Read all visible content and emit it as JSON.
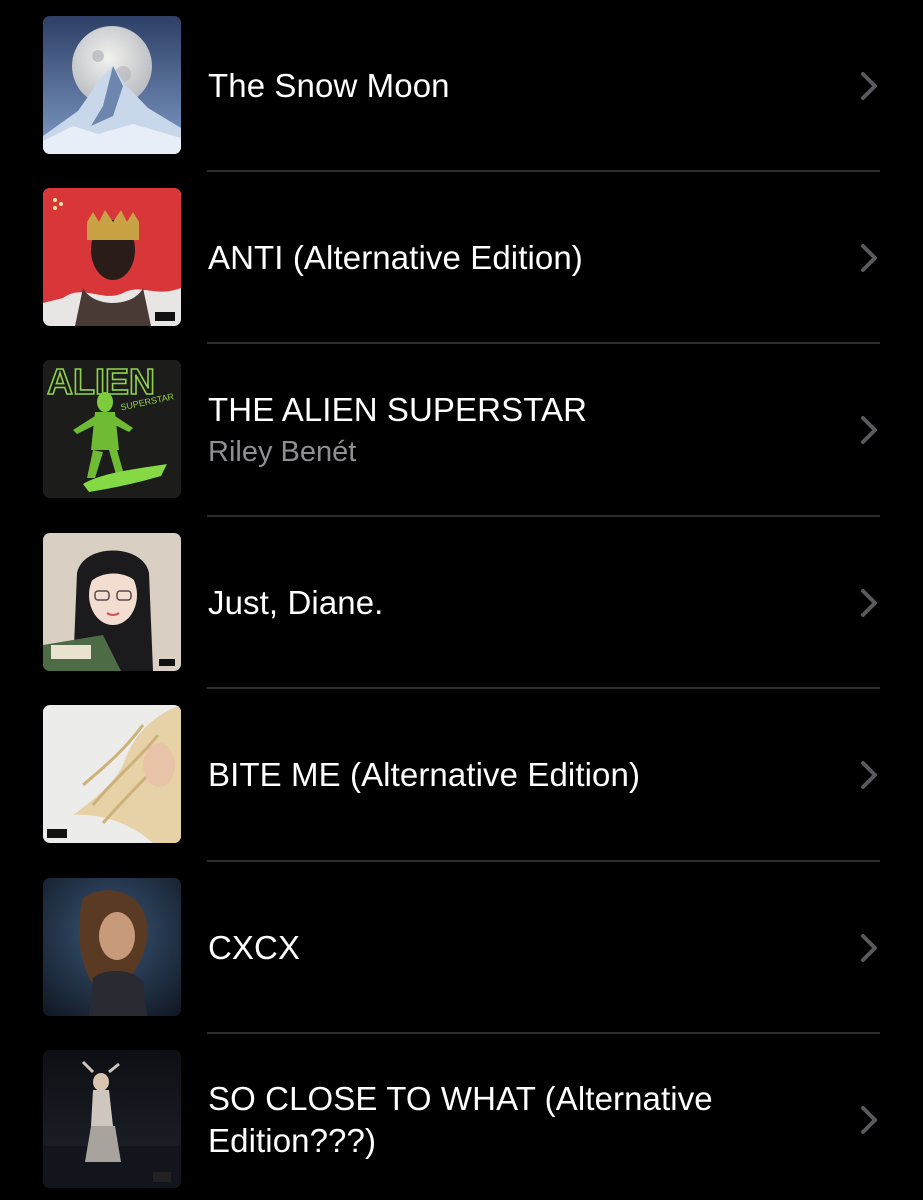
{
  "albums": [
    {
      "title": "The Snow Moon",
      "subtitle": "",
      "icon": "chevron-right-icon"
    },
    {
      "title": "ANTI (Alternative Edition)",
      "subtitle": "",
      "icon": "chevron-right-icon"
    },
    {
      "title": "THE ALIEN SUPERSTAR",
      "subtitle": "Riley Benét",
      "icon": "chevron-right-icon"
    },
    {
      "title": "Just, Diane.",
      "subtitle": "",
      "icon": "chevron-right-icon"
    },
    {
      "title": "BITE ME (Alternative Edition)",
      "subtitle": "",
      "icon": "chevron-right-icon"
    },
    {
      "title": "CXCX",
      "subtitle": "",
      "icon": "chevron-right-icon"
    },
    {
      "title": "SO CLOSE TO WHAT (Alternative Edition???)",
      "subtitle": "",
      "icon": "chevron-right-icon"
    }
  ],
  "artwork_text": {
    "alien_cover_word": "ALIEN",
    "alien_cover_tag": "SUPERSTAR"
  },
  "colors": {
    "background": "#000000",
    "title": "#ffffff",
    "subtitle": "#8e8e93",
    "divider": "#2c2c2e",
    "chevron": "#5a5a5e"
  }
}
